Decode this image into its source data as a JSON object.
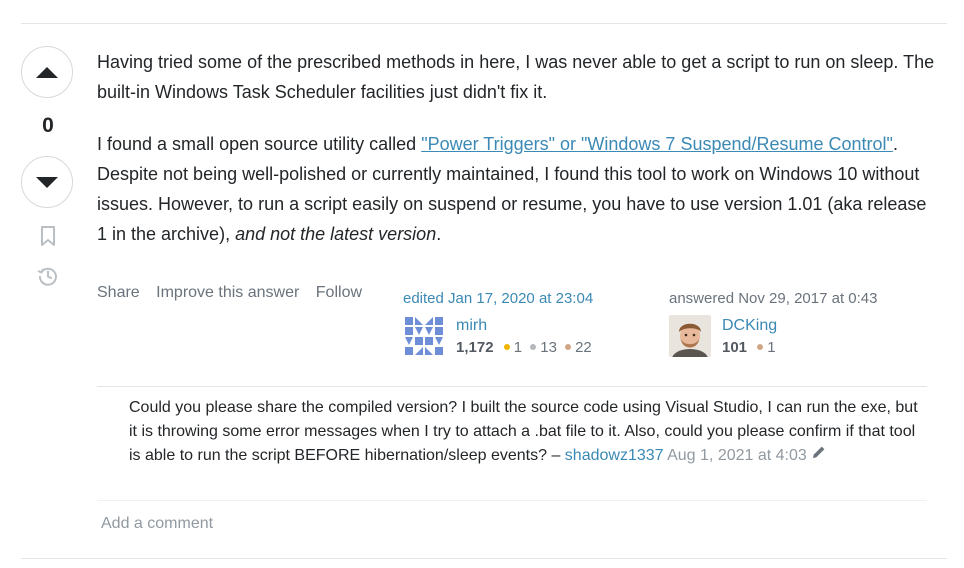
{
  "vote": {
    "count": "0"
  },
  "post": {
    "p1": "Having tried some of the prescribed methods in here, I was never able to get a script to run on sleep. The built-in Windows Task Scheduler facilities just didn't fix it.",
    "p2_start": "I found a small open source utility called ",
    "p2_link": "\"Power Triggers\" or \"Windows 7 Suspend/Resume Control\"",
    "p2_mid": ". Despite not being well-polished or currently maintained, I found this tool to work on Windows 10 without issues. However, to run a script easily on suspend or resume, you have to use version 1.01 (aka release 1 in the archive), ",
    "p2_em": "and not the latest version",
    "p2_end": "."
  },
  "actions": {
    "share": "Share",
    "improve": "Improve this answer",
    "follow": "Follow"
  },
  "editor": {
    "action": "edited Jan 17, 2020 at 23:04",
    "name": "mirh",
    "rep": "1,172",
    "gold": "1",
    "silver": "13",
    "bronze": "22"
  },
  "author": {
    "action": "answered Nov 29, 2017 at 0:43",
    "name": "DCKing",
    "rep": "101",
    "bronze": "1"
  },
  "comment": {
    "text": "Could you please share the compiled version? I built the source code using Visual Studio, I can run the exe, but it is throwing some error messages when I try to attach a .bat file to it. Also, could you please confirm if that tool is able to run the script BEFORE hibernation/sleep events? – ",
    "user": "shadowz1337",
    "date": "Aug 1, 2021 at 4:03"
  },
  "add_comment": "Add a comment",
  "colors": {
    "link": "#3b89b5",
    "muted": "#6a737c",
    "gold": "#f1b600",
    "silver": "#b4b8bc",
    "bronze": "#d1a684"
  },
  "icons": [
    "upvote-icon",
    "downvote-icon",
    "bookmark-icon",
    "history-icon",
    "pencil-icon"
  ]
}
